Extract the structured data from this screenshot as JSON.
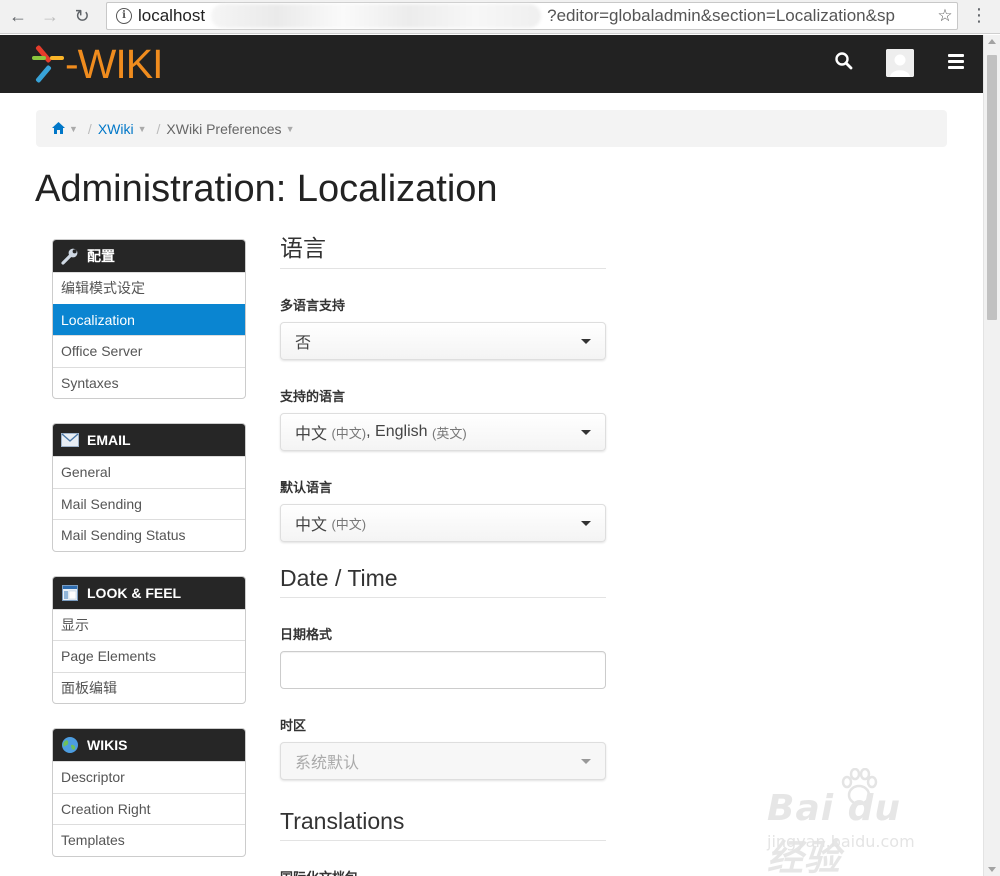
{
  "browser": {
    "url_host": "localhost",
    "url_rest": "?editor=globaladmin&section=Localization&sp"
  },
  "header": {
    "logo_x": "X",
    "logo_dash": "-",
    "logo_text": "WIKI"
  },
  "breadcrumb": {
    "items": [
      "XWiki",
      "XWiki Preferences"
    ],
    "separator": "/"
  },
  "page": {
    "title": "Administration: Localization"
  },
  "admin_menu": {
    "groups": [
      {
        "title": "配置",
        "icon": "wrench-icon",
        "items": [
          "编辑模式设定",
          "Localization",
          "Office Server",
          "Syntaxes"
        ],
        "active": 1
      },
      {
        "title": "EMAIL",
        "icon": "envelope-icon",
        "items": [
          "General",
          "Mail Sending",
          "Mail Sending Status"
        ]
      },
      {
        "title": "LOOK & FEEL",
        "icon": "layout-icon",
        "items": [
          "显示",
          "Page Elements",
          "面板编辑"
        ]
      },
      {
        "title": "WIKIS",
        "icon": "globe-icon",
        "items": [
          "Descriptor",
          "Creation Right",
          "Templates"
        ]
      }
    ]
  },
  "form": {
    "section_language": "语言",
    "multilingual": {
      "label": "多语言支持",
      "value": "否"
    },
    "supported_languages": {
      "label": "支持的语言",
      "value_main1": "中文",
      "value_sub1": "(中文)",
      "value_comma": ",",
      "value_main2": "English",
      "value_sub2": "(英文)"
    },
    "default_language": {
      "label": "默认语言",
      "value_main": "中文",
      "value_sub": "(中文)"
    },
    "section_datetime": "Date / Time",
    "date_format": {
      "label": "日期格式",
      "value": ""
    },
    "timezone": {
      "label": "时区",
      "value": "系统默认"
    },
    "section_translations": "Translations",
    "i18n_docs": {
      "label": "国际化文档包"
    }
  },
  "watermark": {
    "main": "Bai du 经验",
    "sub": "jingyan.baidu.com"
  },
  "colors": {
    "header_bg": "#222222",
    "accent_blue": "#0a85d1",
    "logo_orange": "#f08c1e"
  }
}
